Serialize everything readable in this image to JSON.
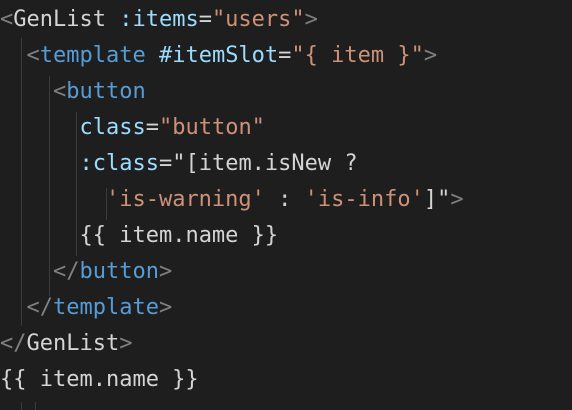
{
  "editor": {
    "language": "vue",
    "theme": "dark",
    "colors": {
      "background": "#1e1e1e",
      "punctuation": "#808080",
      "tag": "#569cd6",
      "attribute": "#9cdcfe",
      "string": "#ce9178",
      "text": "#d4d4d4"
    },
    "lines": [
      [
        {
          "t": "<",
          "c": "punct"
        },
        {
          "t": "GenList",
          "c": "plain"
        },
        {
          "t": " :items",
          "c": "attr"
        },
        {
          "t": "=",
          "c": "plain"
        },
        {
          "t": "\"users\"",
          "c": "str"
        },
        {
          "t": ">",
          "c": "punct"
        }
      ],
      [
        {
          "t": "  ",
          "c": "plain"
        },
        {
          "t": "<",
          "c": "punct"
        },
        {
          "t": "template",
          "c": "tag"
        },
        {
          "t": " #itemSlot",
          "c": "attr"
        },
        {
          "t": "=",
          "c": "plain"
        },
        {
          "t": "\"{ item }\"",
          "c": "str"
        },
        {
          "t": ">",
          "c": "punct"
        }
      ],
      [
        {
          "t": "    ",
          "c": "plain"
        },
        {
          "t": "<",
          "c": "punct"
        },
        {
          "t": "button",
          "c": "tag"
        }
      ],
      [
        {
          "t": "      ",
          "c": "plain"
        },
        {
          "t": "class",
          "c": "attr"
        },
        {
          "t": "=",
          "c": "plain"
        },
        {
          "t": "\"button\"",
          "c": "str"
        }
      ],
      [
        {
          "t": "      ",
          "c": "plain"
        },
        {
          "t": ":class",
          "c": "attr"
        },
        {
          "t": "=\"[item.isNew ?",
          "c": "plain"
        }
      ],
      [
        {
          "t": "        ",
          "c": "plain"
        },
        {
          "t": "'is-warning'",
          "c": "str"
        },
        {
          "t": " : ",
          "c": "plain"
        },
        {
          "t": "'is-info'",
          "c": "str"
        },
        {
          "t": "]\"",
          "c": "plain"
        },
        {
          "t": ">",
          "c": "punct"
        }
      ],
      [
        {
          "t": "      ",
          "c": "plain"
        },
        {
          "t": "{{ item.name }}",
          "c": "plain"
        }
      ],
      [
        {
          "t": "    ",
          "c": "plain"
        },
        {
          "t": "</",
          "c": "punct"
        },
        {
          "t": "button",
          "c": "tag"
        },
        {
          "t": ">",
          "c": "punct"
        }
      ],
      [
        {
          "t": "  ",
          "c": "plain"
        },
        {
          "t": "</",
          "c": "punct"
        },
        {
          "t": "template",
          "c": "tag"
        },
        {
          "t": ">",
          "c": "punct"
        }
      ],
      [
        {
          "t": "</",
          "c": "punct"
        },
        {
          "t": "GenList",
          "c": "plain"
        },
        {
          "t": ">",
          "c": "punct"
        }
      ],
      [
        {
          "t": "{{ item.name }}",
          "c": "plain"
        }
      ],
      [
        {
          "t": "",
          "c": "plain"
        }
      ]
    ]
  }
}
